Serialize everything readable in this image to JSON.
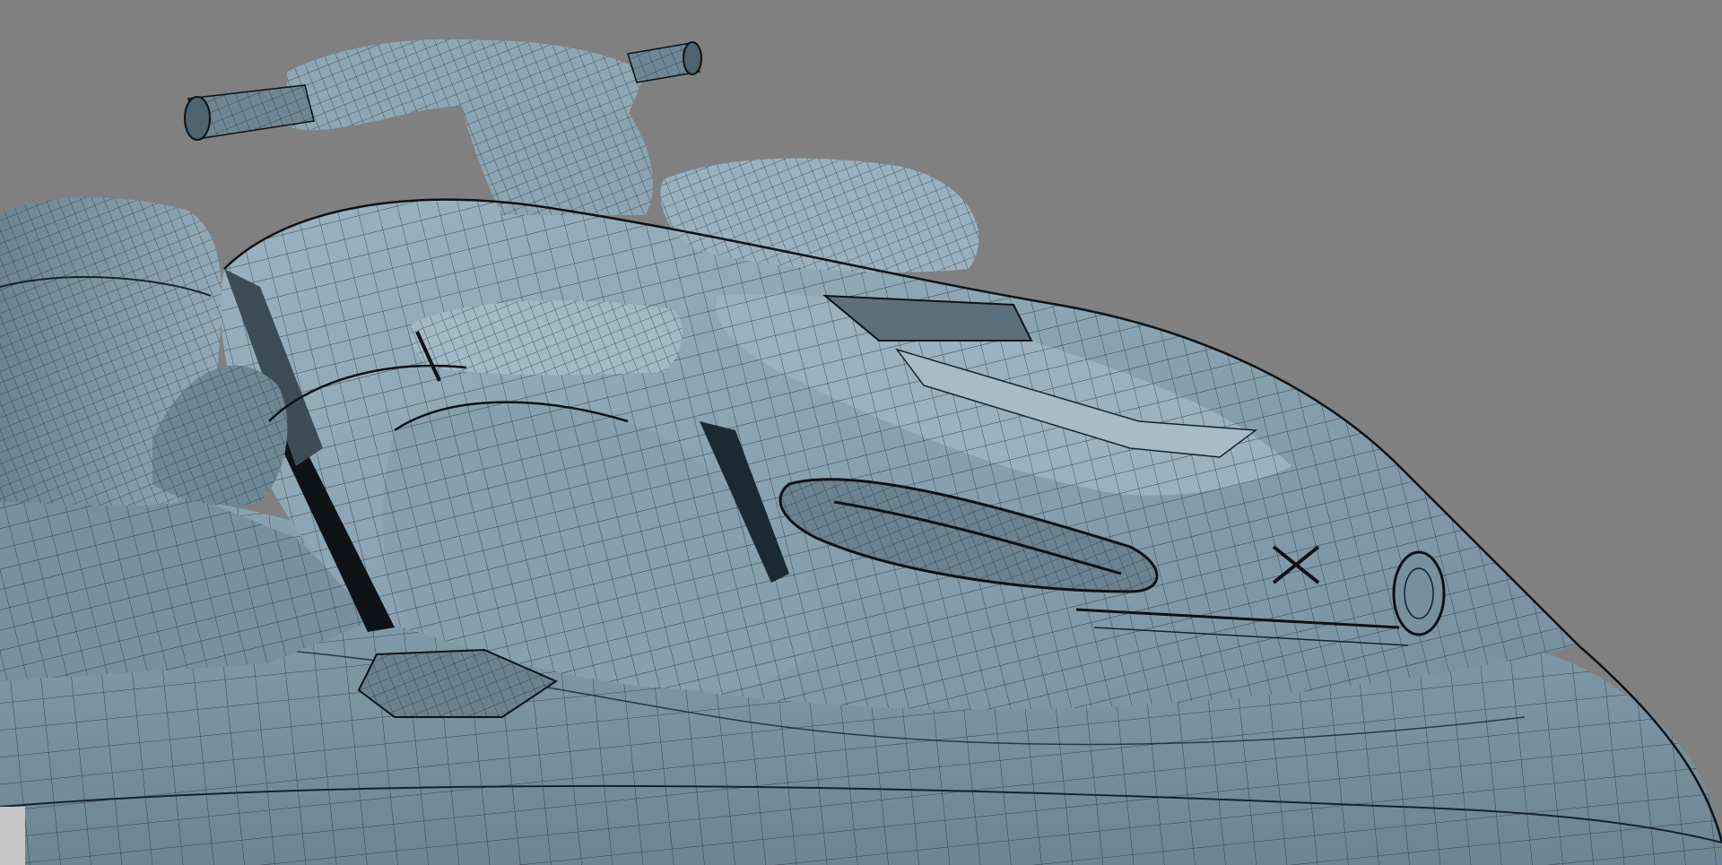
{
  "viewport": {
    "background_color": "#808080",
    "display_mode": "wireframe-on-shaded",
    "object": "jet-ski-hull-mesh",
    "surface_color": "#7f98a6",
    "surface_light": "#a9bfcb",
    "surface_dark": "#4f6470",
    "wire_color": "#15232b",
    "shadow_color": "#0c1216"
  },
  "corner_widget": {
    "color": "#c6c6c6"
  }
}
